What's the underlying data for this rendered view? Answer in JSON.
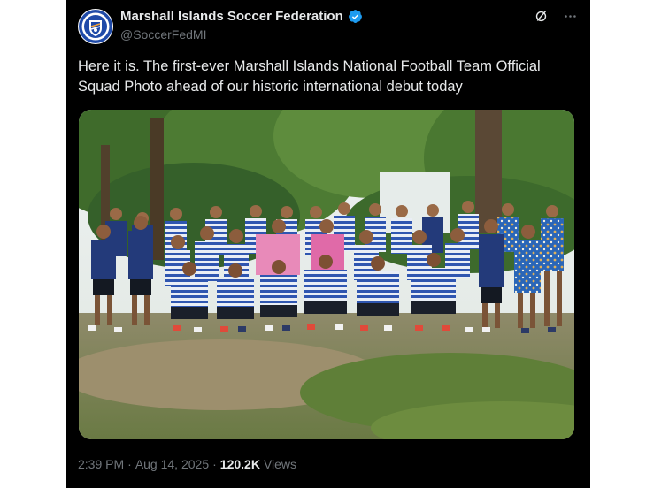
{
  "tweet": {
    "author": {
      "display_name": "Marshall Islands Soccer Federation",
      "handle": "@SoccerFedMI",
      "verified": true,
      "avatar_text": "MARSHALL ISLANDS SOCCER FEDERATION"
    },
    "text": "Here it is. The first-ever Marshall Islands National Football Team Official Squad Photo ahead of our historic international debut today",
    "photo_alt": "Official squad photo",
    "time": "2:39 PM",
    "separator": "·",
    "date": "Aug 14, 2025",
    "views_count": "120.2K",
    "views_label": "Views"
  },
  "icons": {
    "verified": "verified-badge-icon",
    "grok": "grok-icon",
    "more": "more-icon"
  },
  "colors": {
    "background": "#000000",
    "text": "#e7e9ea",
    "muted": "#71767b",
    "verified": "#1d9bf0"
  }
}
